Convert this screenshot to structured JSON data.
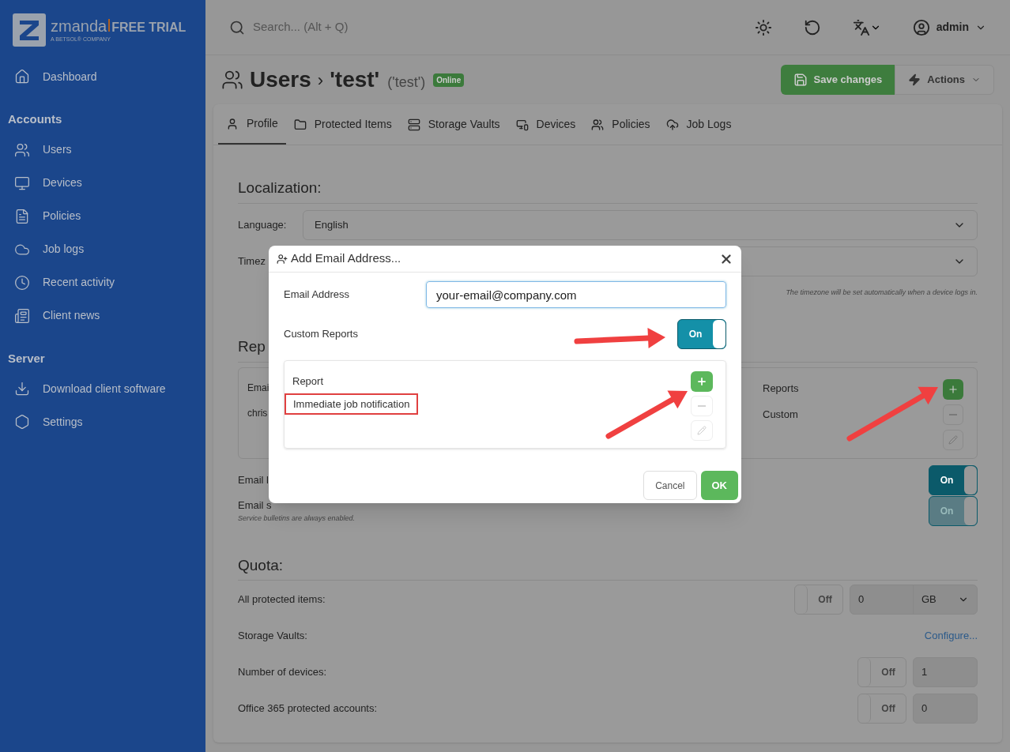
{
  "sidebar": {
    "logo": {
      "brand": "zmanda",
      "edition": "FREE TRIAL",
      "tagline": "A BETSOL® COMPANY"
    },
    "items": [
      {
        "kind": "item",
        "label": "Dashboard"
      },
      {
        "kind": "section",
        "label": "Accounts"
      },
      {
        "kind": "item",
        "label": "Users"
      },
      {
        "kind": "item",
        "label": "Devices"
      },
      {
        "kind": "item",
        "label": "Policies"
      },
      {
        "kind": "item",
        "label": "Job logs"
      },
      {
        "kind": "item",
        "label": "Recent activity"
      },
      {
        "kind": "item",
        "label": "Client news"
      },
      {
        "kind": "section",
        "label": "Server"
      },
      {
        "kind": "item",
        "label": "Download client software"
      },
      {
        "kind": "item",
        "label": "Settings"
      }
    ]
  },
  "topbar": {
    "search_placeholder": "Search... (Alt + Q)",
    "user": "admin"
  },
  "header": {
    "section": "Users",
    "separator": "›",
    "name": "'test'",
    "alias": "('test')",
    "status": "Online",
    "save": "Save changes",
    "actions": "Actions"
  },
  "tabs": [
    {
      "label": "Profile",
      "selected": true
    },
    {
      "label": "Protected Items",
      "selected": false
    },
    {
      "label": "Storage Vaults",
      "selected": false
    },
    {
      "label": "Devices",
      "selected": false
    },
    {
      "label": "Policies",
      "selected": false
    },
    {
      "label": "Job Logs",
      "selected": false
    }
  ],
  "localization": {
    "heading": "Localization:",
    "language_label": "Language:",
    "language_value": "English",
    "timezone_label": "Timez",
    "timezone_hint": "The timezone will be set automatically when a device logs in."
  },
  "reports": {
    "heading": "Rep",
    "columns": [
      "Emai",
      "Reports"
    ],
    "rows": [
      [
        "chris",
        "Custom"
      ]
    ],
    "email_label": "Email l",
    "email_toggle": {
      "label": "On",
      "on": true,
      "disabled": false
    },
    "bulletins_label": "Email s",
    "bulletins_toggle": {
      "label": "On",
      "on": true,
      "disabled": true
    },
    "bulletins_hint": "Service bulletins are always enabled."
  },
  "quota": {
    "heading": "Quota:",
    "rows": [
      {
        "kind": "unit",
        "label": "All protected items:",
        "toggle": {
          "label": "Off",
          "on": false
        },
        "value": "0",
        "unit": "GB"
      },
      {
        "kind": "link",
        "label": "Storage Vaults:",
        "link": "Configure..."
      },
      {
        "kind": "count",
        "label": "Number of devices:",
        "toggle": {
          "label": "Off",
          "on": false
        },
        "value": "1"
      },
      {
        "kind": "count",
        "label": "Office 365 protected accounts:",
        "toggle": {
          "label": "Off",
          "on": false
        },
        "value": "0"
      }
    ]
  },
  "dialog": {
    "title": "Add Email Address...",
    "email_label": "Email Address",
    "email_value": "your-email@company.com",
    "custom_label": "Custom Reports",
    "custom_toggle": {
      "label": "On",
      "on": true,
      "disabled": false
    },
    "report_header": "Report",
    "reports": [
      {
        "label": "Immediate job notification",
        "highlighted": true
      }
    ],
    "cancel": "Cancel",
    "ok": "OK"
  }
}
